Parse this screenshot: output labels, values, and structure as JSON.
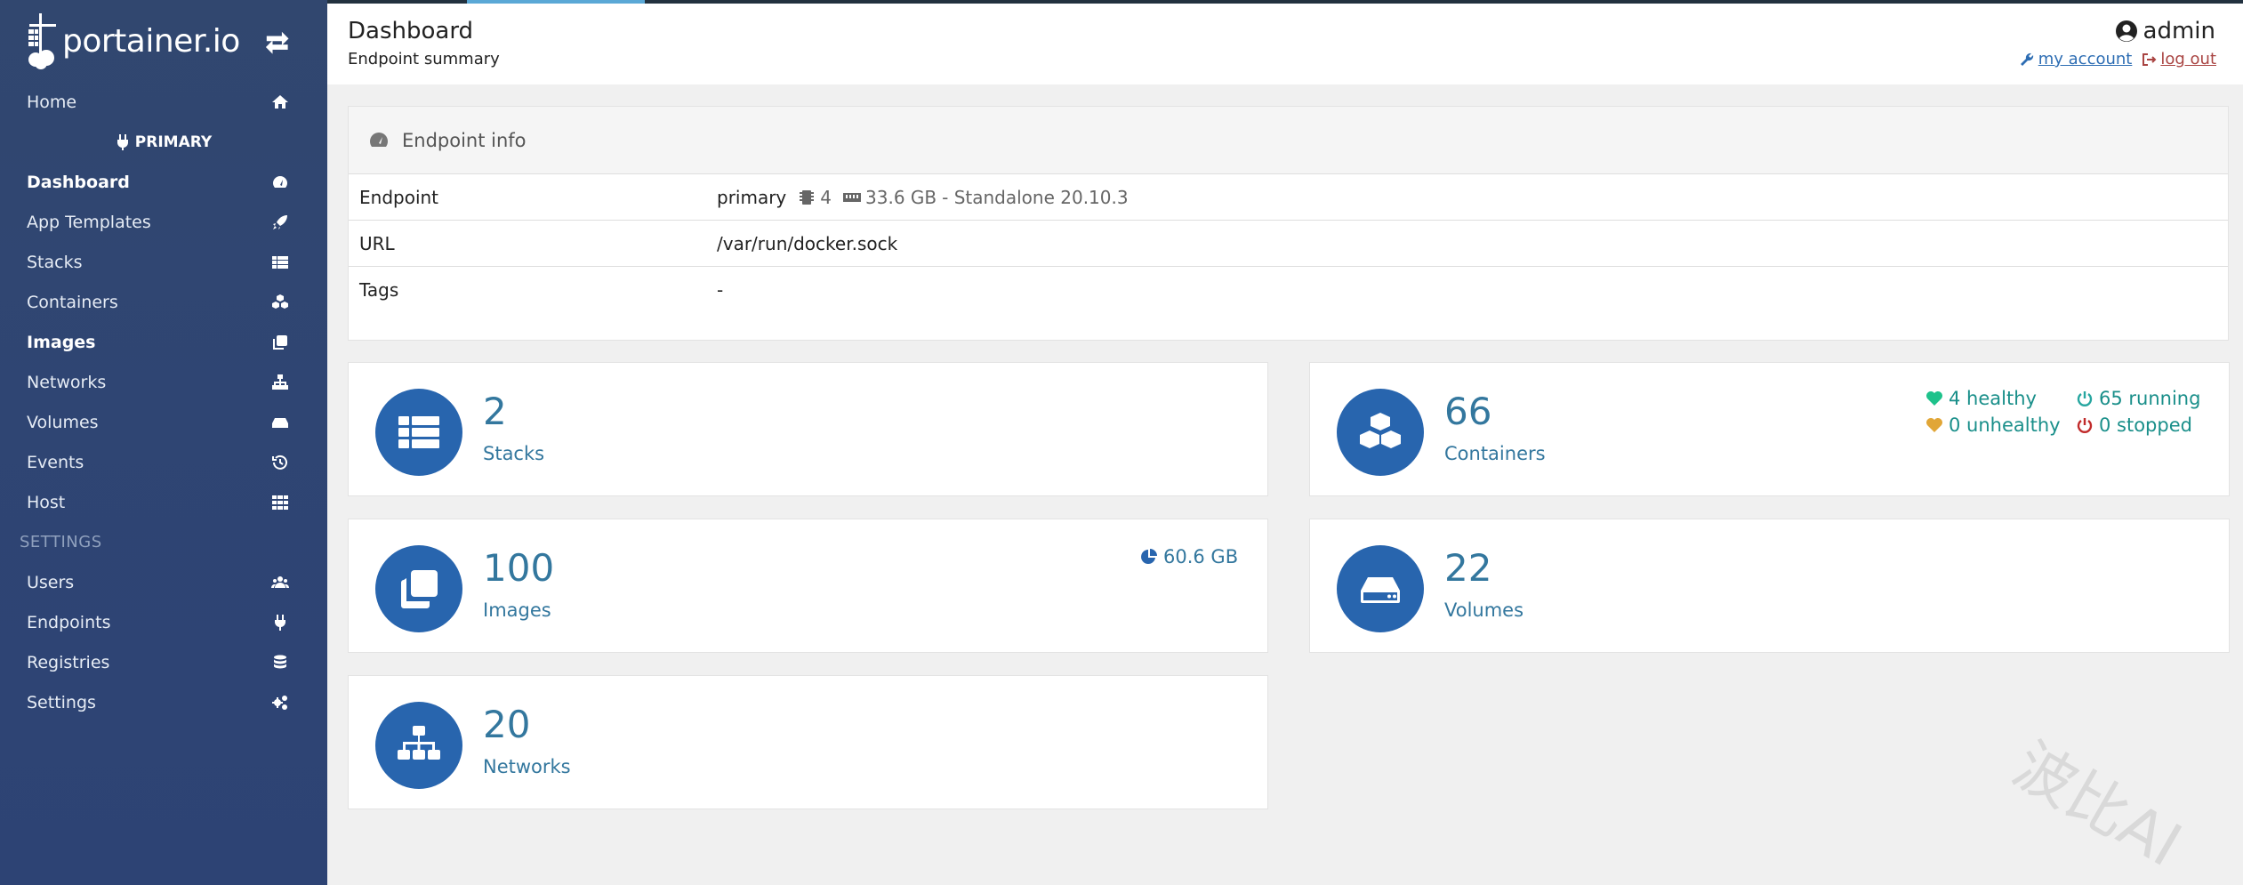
{
  "app": {
    "brand": "portainer.io",
    "colors": {
      "sidebar": "#2f4573",
      "accent": "#2865ae",
      "text_blue": "#33779e",
      "healthy": "#1ec28b",
      "unhealthy": "#e1a637",
      "stopped": "#c12b2b",
      "running": "#27a6a0"
    }
  },
  "sidebar": {
    "items": [
      {
        "label": "Home",
        "icon": "home-icon"
      },
      {
        "label": "Dashboard",
        "icon": "tachometer-icon"
      },
      {
        "label": "App Templates",
        "icon": "rocket-icon"
      },
      {
        "label": "Stacks",
        "icon": "th-list-icon"
      },
      {
        "label": "Containers",
        "icon": "cubes-icon"
      },
      {
        "label": "Images",
        "icon": "clone-icon"
      },
      {
        "label": "Networks",
        "icon": "sitemap-icon"
      },
      {
        "label": "Volumes",
        "icon": "hdd-icon"
      },
      {
        "label": "Events",
        "icon": "history-icon"
      },
      {
        "label": "Host",
        "icon": "th-icon"
      }
    ],
    "endpoint_label": "PRIMARY",
    "settings_header": "SETTINGS",
    "settings_items": [
      {
        "label": "Users",
        "icon": "users-icon"
      },
      {
        "label": "Endpoints",
        "icon": "plug-icon"
      },
      {
        "label": "Registries",
        "icon": "database-icon"
      },
      {
        "label": "Settings",
        "icon": "cogs-icon"
      }
    ]
  },
  "header": {
    "title": "Dashboard",
    "subtitle": "Endpoint summary",
    "user": "admin",
    "my_account": "my account",
    "log_out": "log out"
  },
  "endpoint_info": {
    "title": "Endpoint info",
    "rows": {
      "endpoint": {
        "key": "Endpoint",
        "name": "primary",
        "cpu": "4",
        "memory": "33.6 GB",
        "mode": "- Standalone 20.10.3"
      },
      "url": {
        "key": "URL",
        "value": "/var/run/docker.sock"
      },
      "tags": {
        "key": "Tags",
        "value": "-"
      }
    }
  },
  "tiles": {
    "stacks": {
      "count": "2",
      "label": "Stacks"
    },
    "containers": {
      "count": "66",
      "label": "Containers",
      "healthy": "4 healthy",
      "unhealthy": "0 unhealthy",
      "running": "65 running",
      "stopped": "0 stopped"
    },
    "images": {
      "count": "100",
      "label": "Images",
      "size": "60.6 GB"
    },
    "volumes": {
      "count": "22",
      "label": "Volumes"
    },
    "networks": {
      "count": "20",
      "label": "Networks"
    }
  },
  "watermark": "波比AI"
}
